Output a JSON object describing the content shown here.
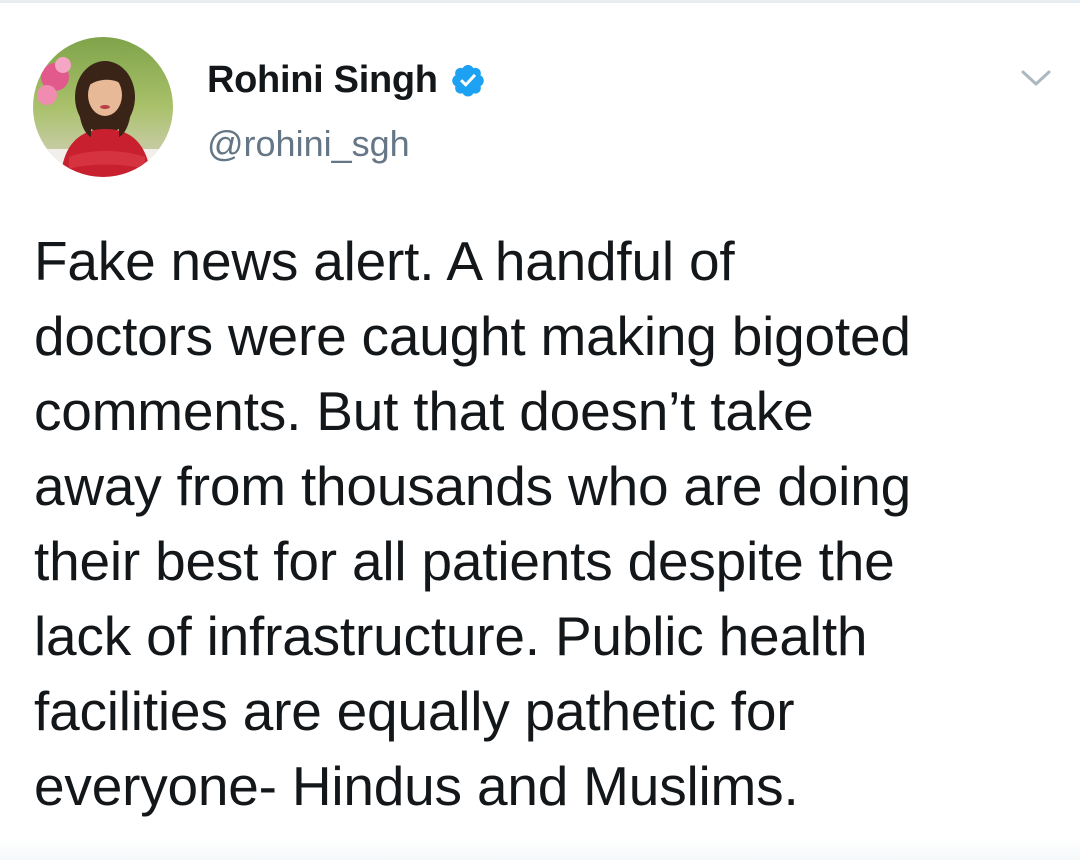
{
  "tweet": {
    "author": {
      "display_name": "Rohini Singh",
      "handle": "@rohini_sgh",
      "verified": true,
      "avatar_icon": "profile-photo"
    },
    "text": "Fake news alert. A handful of\ndoctors were caught making bigoted\ncomments. But that doesn’t take\naway from thousands who are doing\ntheir best for all patients despite the\nlack of infrastructure. Public health\nfacilities are equally pathetic for\neveryone- Hindus and Muslims.",
    "menu_icon": "chevron-down-icon"
  },
  "colors": {
    "text_primary": "#14171a",
    "text_secondary": "#657786",
    "verified_blue": "#1da1f2",
    "caret_gray": "#aab8c2",
    "divider": "#e6ecf0"
  }
}
